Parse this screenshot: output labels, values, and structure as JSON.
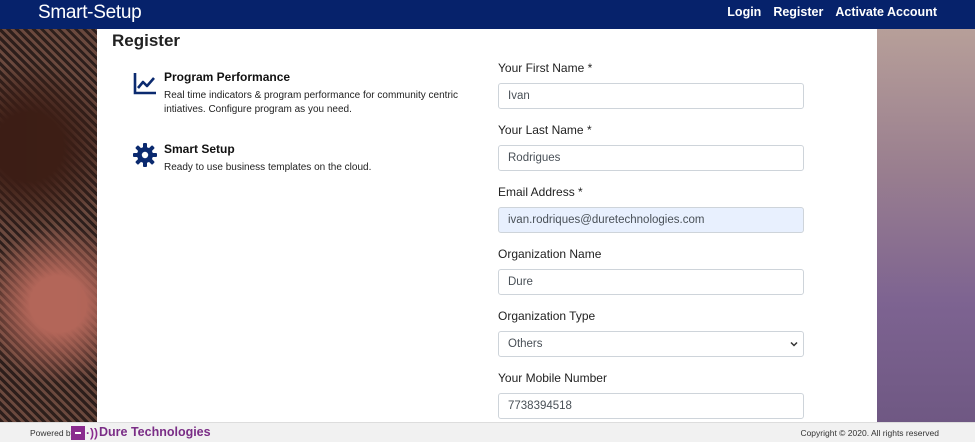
{
  "app": {
    "brand": "Smart-Setup",
    "nav": [
      "Login",
      "Register",
      "Activate Account"
    ]
  },
  "page": {
    "title": "Register"
  },
  "features": [
    {
      "icon": "chart-line-icon",
      "title": "Program Performance",
      "description": "Real time indicators & program performance for community centric intiatives. Configure program as you need."
    },
    {
      "icon": "gear-icon",
      "title": "Smart Setup",
      "description": "Ready to use business templates on the cloud."
    }
  ],
  "form": {
    "first_name": {
      "label": "Your First Name *",
      "value": "Ivan"
    },
    "last_name": {
      "label": "Your Last Name *",
      "value": "Rodrigues"
    },
    "email": {
      "label": "Email Address *",
      "value": "ivan.rodriques@duretechnologies.com"
    },
    "organization_name": {
      "label": "Organization Name",
      "value": "Dure"
    },
    "organization_type": {
      "label": "Organization Type",
      "value": "Others"
    },
    "mobile": {
      "label": "Your Mobile Number",
      "value": "7738394518"
    }
  },
  "footer": {
    "powered_by": "Powered by",
    "company": "Dure Technologies",
    "logo_waves": "·))",
    "copyright": "Copyright © 2020. All rights reserved"
  },
  "colors": {
    "navbar": "#06226b",
    "accent_icon": "#0b2a6f",
    "logo": "#8a2b8e",
    "autofill": "#e8f0fe"
  }
}
